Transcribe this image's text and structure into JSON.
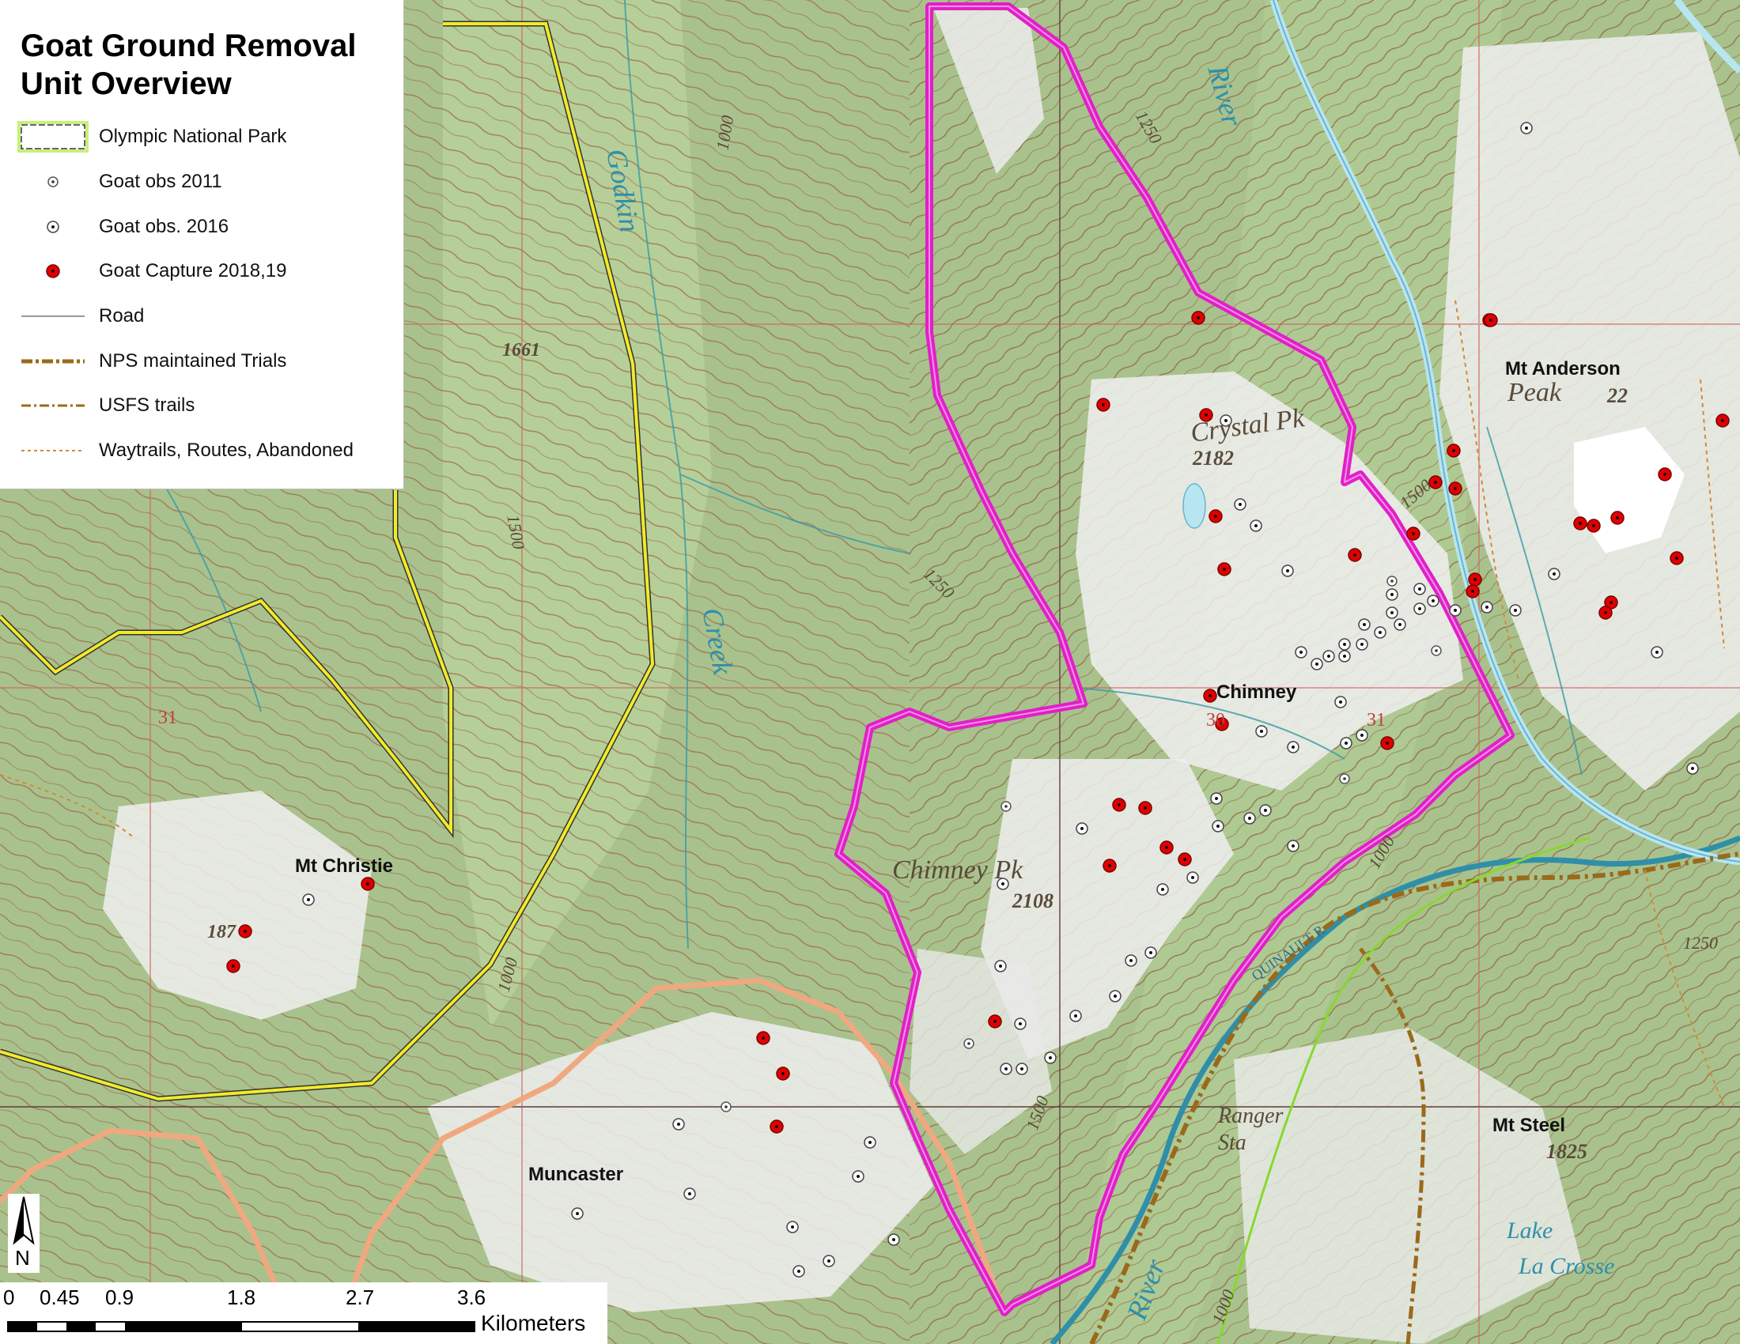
{
  "title": "Goat Ground Removal\nUnit Overview",
  "legend": [
    {
      "label": "Olympic National Park",
      "symbol": "park-boundary-icon"
    },
    {
      "label": "Goat obs 2011",
      "symbol": "goat-obs-2011-icon"
    },
    {
      "label": "Goat obs. 2016",
      "symbol": "goat-obs-2016-icon"
    },
    {
      "label": "Goat Capture 2018,19",
      "symbol": "goat-capture-icon"
    },
    {
      "label": "Road",
      "symbol": "road-line-icon"
    },
    {
      "label": "NPS maintained Trials",
      "symbol": "nps-trail-icon"
    },
    {
      "label": "USFS trails",
      "symbol": "usfs-trail-icon"
    },
    {
      "label": "Waytrails, Routes, Abandoned",
      "symbol": "waytrail-icon"
    }
  ],
  "colors": {
    "unit_boundary": "#e020c8",
    "park_boundary": "#f2ea2a",
    "salmon_boundary": "#f0a880",
    "river": "#2f8fa8",
    "road_river": "#b8e6f0",
    "capture": "#e00000",
    "terrain": "#a9c28d",
    "contour": "#9a6a4a",
    "grid": "#d06060",
    "nps_trail": "#9a6a1a",
    "green_line": "#88d830"
  },
  "places": {
    "mt_christie": "Mt Christie",
    "chimney": "Chimney",
    "mt_anderson": "Mt Anderson",
    "muncaster": "Muncaster",
    "mt_steel": "Mt Steel"
  },
  "topo_text": {
    "crystal_pk": "Crystal Pk",
    "crystal_elev": "2182",
    "chimney_pk": "Chimney Pk",
    "chimney_elev": "2108",
    "peak": "Peak",
    "anderson_elev": "22",
    "godkin": "Godkin",
    "creek": "Creek",
    "river": "River",
    "river_s": "River",
    "quinault": "QUINAULT R",
    "ranger": "Ranger",
    "sta": "Sta",
    "lake": "Lake",
    "la_crosse": "La Crosse",
    "steel_elev": "1825",
    "elev_1661": "1661",
    "c1000_a": "1000",
    "c1000_b": "1000",
    "c1000_c": "1000",
    "c1000_d": "1000",
    "c1250_a": "1250",
    "c1250_b": "1250",
    "c1250_c": "1250",
    "c1500_a": "1500",
    "c1500_b": "1500",
    "c1500_c": "1500",
    "sec_30": "30",
    "sec_31a": "31",
    "sec_31b": "31",
    "christie_elev": "187"
  },
  "scalebar": {
    "ticks": [
      "0",
      "0.45",
      "0.9",
      "1.8",
      "2.7",
      "3.6"
    ],
    "unit": "Kilometers"
  },
  "north_label": "N"
}
